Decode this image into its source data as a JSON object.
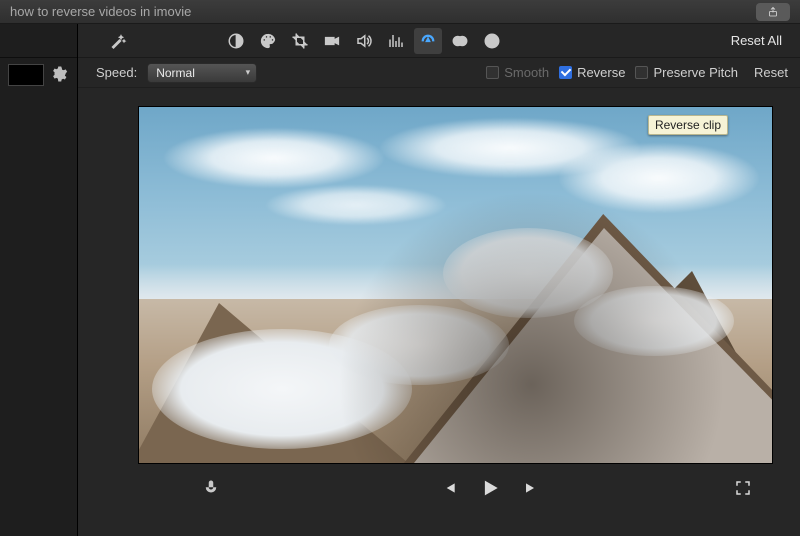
{
  "titlebar": {
    "title": "how to reverse videos in imovie"
  },
  "toolbar": {
    "reset_all": "Reset All"
  },
  "speed": {
    "label": "Speed:",
    "value": "Normal",
    "smooth_label": "Smooth",
    "smooth_checked": false,
    "smooth_enabled": false,
    "reverse_label": "Reverse",
    "reverse_checked": true,
    "preserve_label": "Preserve Pitch",
    "preserve_checked": false,
    "reset": "Reset"
  },
  "tooltip": {
    "text": "Reverse clip"
  }
}
